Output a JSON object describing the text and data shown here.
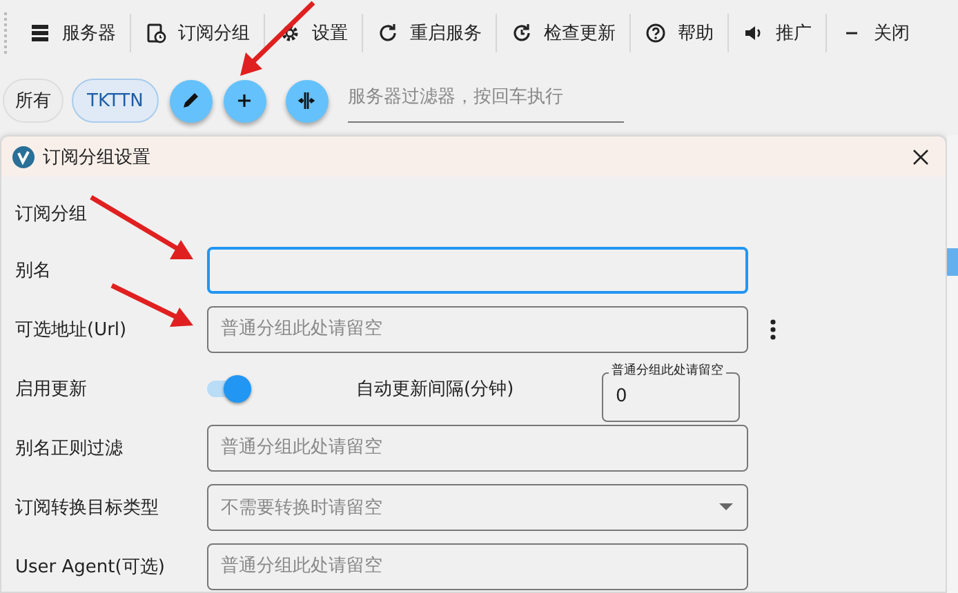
{
  "toolbar": [
    {
      "label": "服务器"
    },
    {
      "label": "订阅分组"
    },
    {
      "label": "设置"
    },
    {
      "label": "重启服务"
    },
    {
      "label": "检查更新"
    },
    {
      "label": "帮助"
    },
    {
      "label": "推广"
    },
    {
      "label": "关闭"
    }
  ],
  "groups": [
    {
      "label": "所有",
      "selected": false
    },
    {
      "label": "TKTTN",
      "selected": true
    }
  ],
  "actions": [
    {
      "kind": "edit"
    },
    {
      "kind": "add"
    },
    {
      "kind": "split"
    }
  ],
  "filter": {
    "placeholder": "服务器过滤器，按回车执行"
  },
  "dialog": {
    "title": "订阅分组设置",
    "section": "订阅分组",
    "fields": [
      {
        "kind": "text",
        "label": "别名",
        "focused": true
      },
      {
        "kind": "text-menu",
        "label": "可选地址(Url)",
        "placeholder": "普通分组此处请留空"
      },
      {
        "kind": "toggle",
        "label": "启用更新",
        "on": true,
        "interval_label": "自动更新间隔(分钟)",
        "interval_legend": "普通分组此处请留空",
        "interval_value": "0"
      },
      {
        "kind": "text",
        "label": "别名正则过滤",
        "placeholder": "普通分组此处请留空"
      },
      {
        "kind": "select",
        "label": "订阅转换目标类型",
        "placeholder": "不需要转换时请留空"
      },
      {
        "kind": "text",
        "label": "User Agent(可选)",
        "placeholder": "普通分组此处请留空"
      }
    ]
  }
}
